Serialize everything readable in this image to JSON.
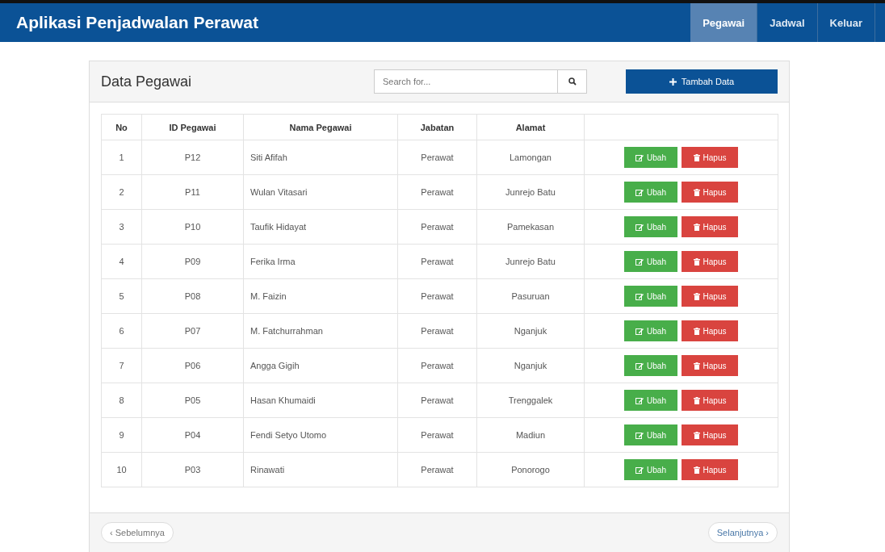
{
  "navbar": {
    "brand": "Aplikasi Penjadwalan Perawat",
    "items": [
      {
        "label": "Pegawai",
        "selected": true
      },
      {
        "label": "Jadwal",
        "selected": false
      },
      {
        "label": "Keluar",
        "selected": false
      }
    ]
  },
  "panel": {
    "title": "Data Pegawai",
    "search": {
      "placeholder": "Search for..."
    },
    "add_button": "Tambah Data"
  },
  "table": {
    "columns": [
      "No",
      "ID Pegawai",
      "Nama Pegawai",
      "Jabatan",
      "Alamat"
    ],
    "rows": [
      {
        "no": "1",
        "id": "P12",
        "name": "Siti Afifah",
        "position": "Perawat",
        "address": "Lamongan",
        "edit_label": "Ubah",
        "delete_label": "Hapus"
      },
      {
        "no": "2",
        "id": "P11",
        "name": "Wulan Vitasari",
        "position": "Perawat",
        "address": "Junrejo Batu",
        "edit_label": "Ubah",
        "delete_label": "Hapus"
      },
      {
        "no": "3",
        "id": "P10",
        "name": "Taufik Hidayat",
        "position": "Perawat",
        "address": "Pamekasan",
        "edit_label": "Ubah",
        "delete_label": "Hapus"
      },
      {
        "no": "4",
        "id": "P09",
        "name": "Ferika Irma",
        "position": "Perawat",
        "address": "Junrejo Batu",
        "edit_label": "Ubah",
        "delete_label": "Hapus"
      },
      {
        "no": "5",
        "id": "P08",
        "name": "M. Faizin",
        "position": "Perawat",
        "address": "Pasuruan",
        "edit_label": "Ubah",
        "delete_label": "Hapus"
      },
      {
        "no": "6",
        "id": "P07",
        "name": "M. Fatchurrahman",
        "position": "Perawat",
        "address": "Nganjuk",
        "edit_label": "Ubah",
        "delete_label": "Hapus"
      },
      {
        "no": "7",
        "id": "P06",
        "name": "Angga Gigih",
        "position": "Perawat",
        "address": "Nganjuk",
        "edit_label": "Ubah",
        "delete_label": "Hapus"
      },
      {
        "no": "8",
        "id": "P05",
        "name": "Hasan Khumaidi",
        "position": "Perawat",
        "address": "Trenggalek",
        "edit_label": "Ubah",
        "delete_label": "Hapus"
      },
      {
        "no": "9",
        "id": "P04",
        "name": "Fendi Setyo Utomo",
        "position": "Perawat",
        "address": "Madiun",
        "edit_label": "Ubah",
        "delete_label": "Hapus"
      },
      {
        "no": "10",
        "id": "P03",
        "name": "Rinawati",
        "position": "Perawat",
        "address": "Ponorogo",
        "edit_label": "Ubah",
        "delete_label": "Hapus"
      }
    ]
  },
  "pager": {
    "previous": "‹ Sebelumnya",
    "next": "Selanjutnya ›"
  }
}
